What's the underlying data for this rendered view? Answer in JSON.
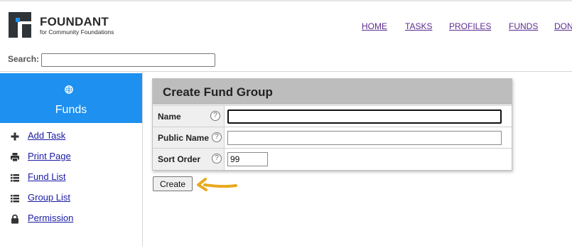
{
  "logo": {
    "name": "FOUNDANT",
    "tagline": "for Community Foundations"
  },
  "nav": {
    "items": [
      "HOME",
      "TASKS",
      "PROFILES",
      "FUNDS",
      "DON"
    ]
  },
  "search": {
    "label": "Search:",
    "value": ""
  },
  "sidebar": {
    "title": "Funds",
    "icon": "globe-icon",
    "items": [
      {
        "label": "Add Task",
        "icon": "plus-icon"
      },
      {
        "label": "Print Page",
        "icon": "printer-icon"
      },
      {
        "label": "Fund List",
        "icon": "list-icon"
      },
      {
        "label": "Group List",
        "icon": "list-icon"
      },
      {
        "label": "Permission",
        "icon": "lock-icon"
      }
    ]
  },
  "form": {
    "title": "Create Fund Group",
    "fields": [
      {
        "label": "Name",
        "value": ""
      },
      {
        "label": "Public Name",
        "value": ""
      },
      {
        "label": "Sort Order",
        "value": "99"
      }
    ],
    "help_glyph": "?",
    "submit_label": "Create"
  },
  "colors": {
    "accent": "#1E90EF",
    "nav_link": "#5B2C8F",
    "arrow": "#F0B429",
    "panel_header": "#BDBDBD"
  }
}
